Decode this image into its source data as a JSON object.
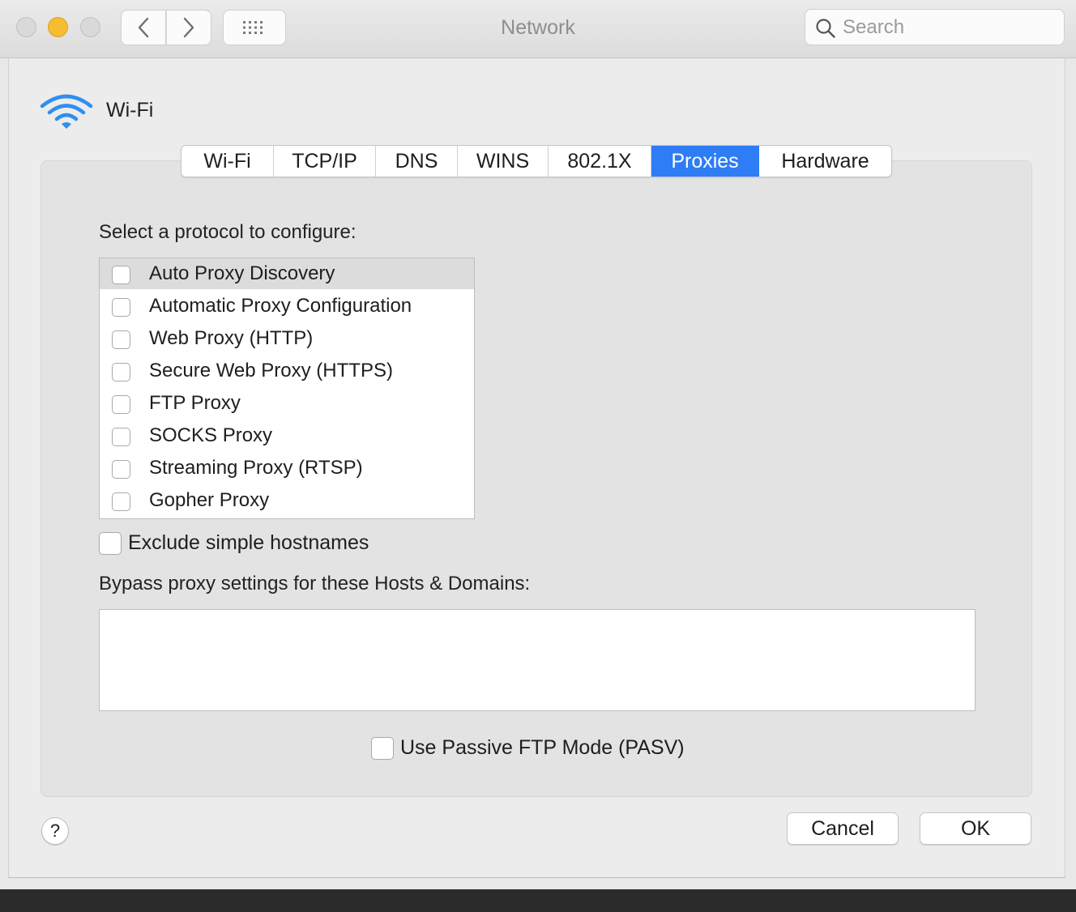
{
  "window": {
    "title": "Network"
  },
  "search": {
    "placeholder": "Search"
  },
  "interface": {
    "name": "Wi-Fi",
    "icon": "wifi-icon"
  },
  "tabs": [
    {
      "label": "Wi-Fi",
      "active": false
    },
    {
      "label": "TCP/IP",
      "active": false
    },
    {
      "label": "DNS",
      "active": false
    },
    {
      "label": "WINS",
      "active": false
    },
    {
      "label": "802.1X",
      "active": false
    },
    {
      "label": "Proxies",
      "active": true
    },
    {
      "label": "Hardware",
      "active": false
    }
  ],
  "proxies": {
    "select_label": "Select a protocol to configure:",
    "protocols": [
      {
        "label": "Auto Proxy Discovery",
        "checked": false,
        "selected": true
      },
      {
        "label": "Automatic Proxy Configuration",
        "checked": false,
        "selected": false
      },
      {
        "label": "Web Proxy (HTTP)",
        "checked": false,
        "selected": false
      },
      {
        "label": "Secure Web Proxy (HTTPS)",
        "checked": false,
        "selected": false
      },
      {
        "label": "FTP Proxy",
        "checked": false,
        "selected": false
      },
      {
        "label": "SOCKS Proxy",
        "checked": false,
        "selected": false
      },
      {
        "label": "Streaming Proxy (RTSP)",
        "checked": false,
        "selected": false
      },
      {
        "label": "Gopher Proxy",
        "checked": false,
        "selected": false
      }
    ],
    "exclude_simple_hostnames": {
      "label": "Exclude simple hostnames",
      "checked": false
    },
    "bypass_label": "Bypass proxy settings for these Hosts & Domains:",
    "bypass_value": "",
    "passive_ftp": {
      "label": "Use Passive FTP Mode (PASV)",
      "checked": false
    }
  },
  "footer": {
    "help_label": "?",
    "cancel_label": "Cancel",
    "ok_label": "OK"
  },
  "colors": {
    "accent": "#2e7cf6",
    "minimize": "#f5bd2f"
  }
}
